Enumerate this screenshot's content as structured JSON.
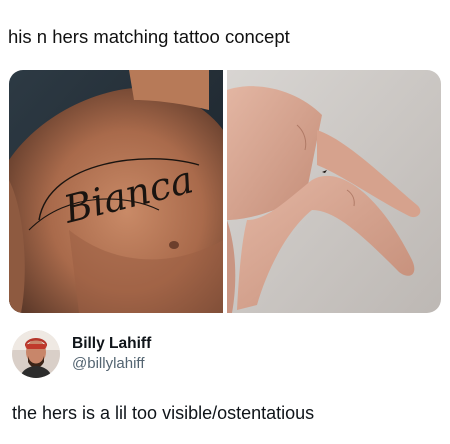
{
  "post": {
    "title": "his n hers matching tattoo concept",
    "images": [
      {
        "alt": "",
        "tattoo_text": "Bianca"
      },
      {
        "alt": ""
      }
    ]
  },
  "reply": {
    "author": {
      "name": "Billy Lahiff",
      "handle": "@billylahiff"
    },
    "text": "the hers is a lil too visible/ostentatious"
  }
}
